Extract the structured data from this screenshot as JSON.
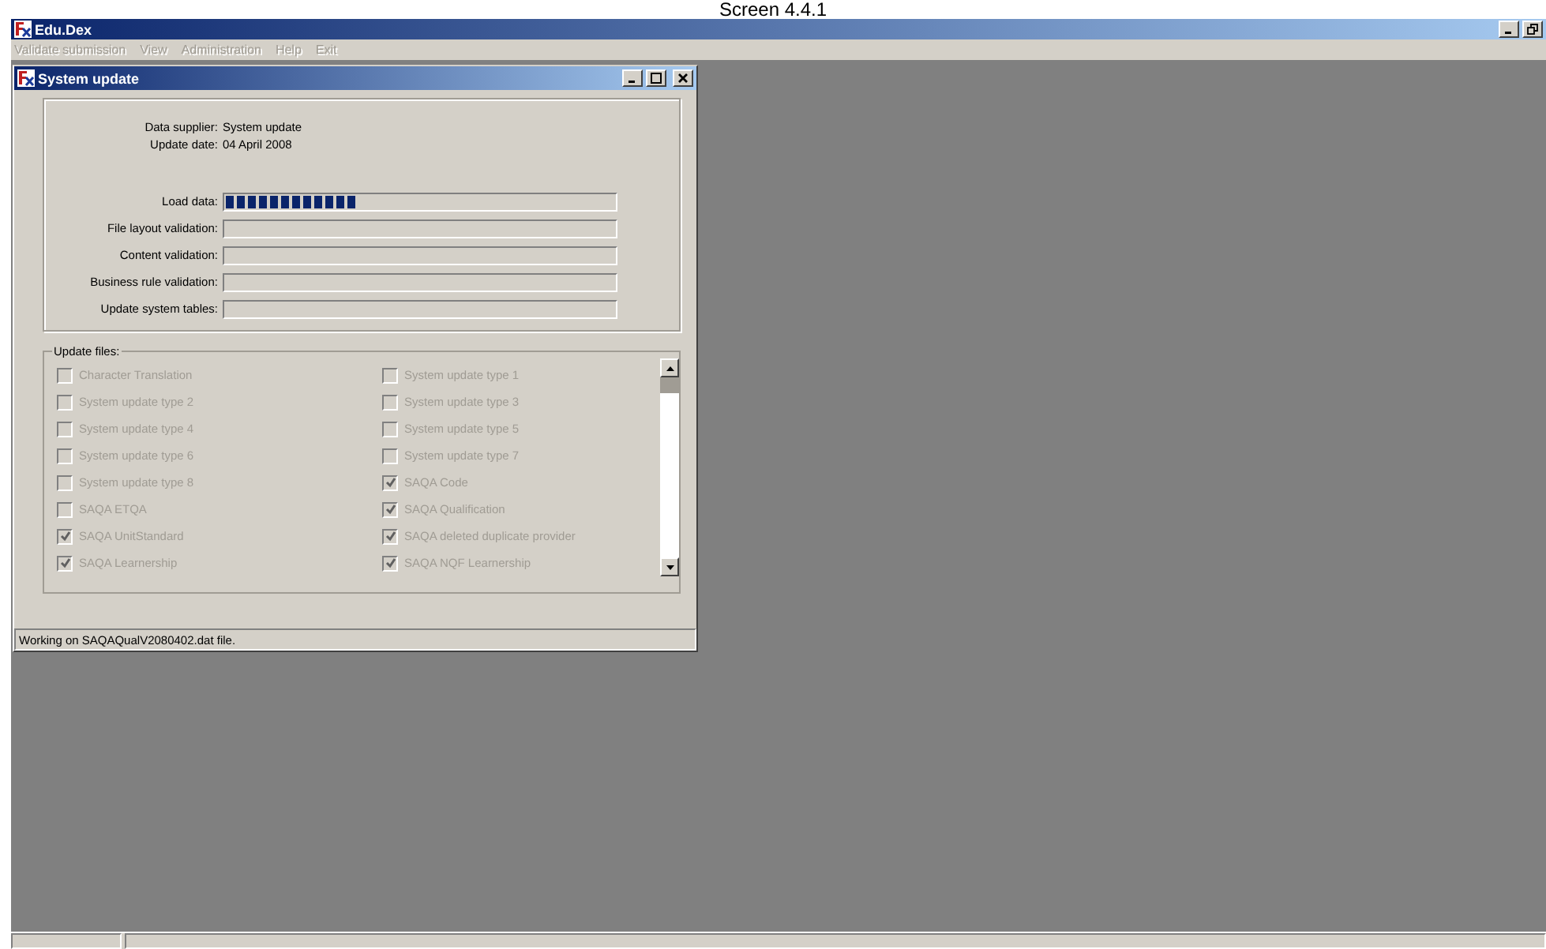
{
  "caption": "Screen 4.4.1",
  "window": {
    "title": "Edu.Dex"
  },
  "menu": [
    {
      "label": "Validate submission",
      "disabled": true
    },
    {
      "label": "View",
      "disabled": true
    },
    {
      "label": "Administration",
      "disabled": true
    },
    {
      "label": "Help",
      "disabled": true
    },
    {
      "label": "Exit",
      "disabled": true
    }
  ],
  "dialog": {
    "title": "System update",
    "info": [
      {
        "label": "Data supplier:",
        "value": "System update"
      },
      {
        "label": "Update date:",
        "value": "04 April 2008"
      }
    ],
    "steps": [
      {
        "label": "Load data:",
        "level": 0.34
      },
      {
        "label": "File layout validation:"
      },
      {
        "label": "Content validation:"
      },
      {
        "label": "Business rule validation:"
      },
      {
        "label": "Update system tables:"
      }
    ],
    "files_title": "Update files:",
    "files": [
      {
        "label": "Character Translation",
        "checked": false,
        "disabled": true
      },
      {
        "label": "System update type 1",
        "checked": false,
        "disabled": true
      },
      {
        "label": "System update type 2",
        "checked": false,
        "disabled": true
      },
      {
        "label": "System update type 3",
        "checked": false,
        "disabled": true
      },
      {
        "label": "System update type 4",
        "checked": false,
        "disabled": true
      },
      {
        "label": "System update type 5",
        "checked": false,
        "disabled": true
      },
      {
        "label": "System update type 6",
        "checked": false,
        "disabled": true
      },
      {
        "label": "System update type 7",
        "checked": false,
        "disabled": true
      },
      {
        "label": "System update type 8",
        "checked": false,
        "disabled": true
      },
      {
        "label": "SAQA Code",
        "checked": true,
        "disabled": true
      },
      {
        "label": "SAQA ETQA",
        "checked": false,
        "disabled": true
      },
      {
        "label": "SAQA Qualification",
        "checked": true,
        "disabled": true
      },
      {
        "label": "SAQA UnitStandard",
        "checked": true,
        "disabled": true
      },
      {
        "label": "SAQA deleted duplicate provider",
        "checked": true,
        "disabled": true
      },
      {
        "label": "SAQA Learnership",
        "checked": true,
        "disabled": true
      },
      {
        "label": "SAQA NQF Learnership",
        "checked": true,
        "disabled": true
      }
    ],
    "status": "Working on SAQAQualV2080402.dat file."
  }
}
